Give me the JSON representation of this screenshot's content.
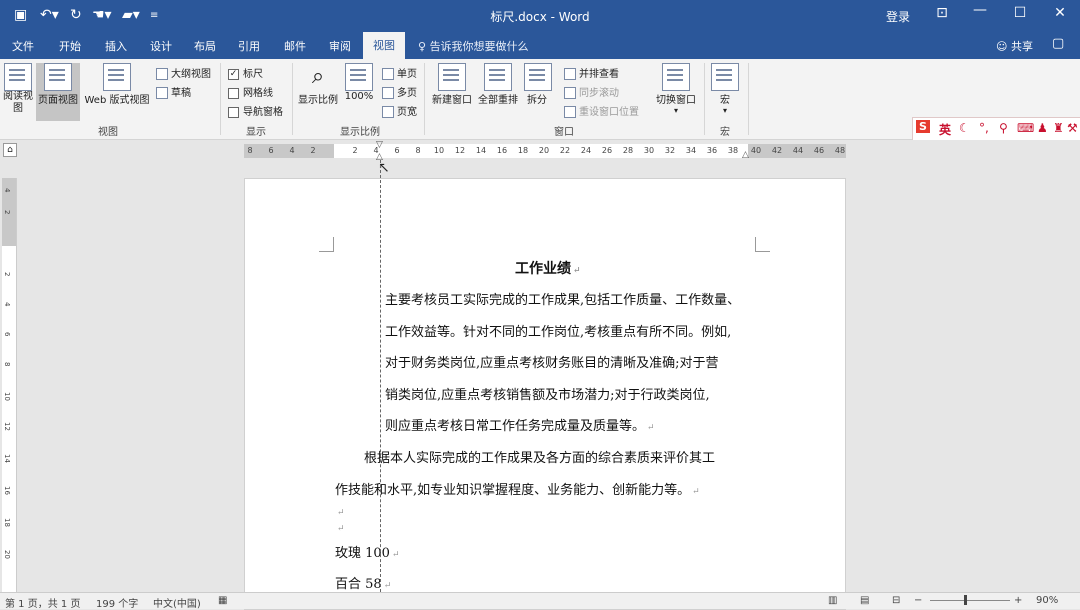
{
  "titlebar": {
    "title": "标尺.docx - Word",
    "login": "登录",
    "qa_icons": [
      "save-icon",
      "undo-icon",
      "redo-icon",
      "touch-icon",
      "open-folder-icon",
      "customize-icon"
    ]
  },
  "tabs": [
    "文件",
    "开始",
    "插入",
    "设计",
    "布局",
    "引用",
    "邮件",
    "审阅",
    "视图"
  ],
  "active_tab": "视图",
  "tell_me": "告诉我你想要做什么",
  "share": "共享",
  "ribbon": {
    "views": {
      "label": "视图",
      "read": "阅读视图",
      "print_layout": "页面视图",
      "web": "Web 版式视图",
      "outline": "大纲视图",
      "draft": "草稿"
    },
    "show": {
      "label": "显示",
      "ruler": "标尺",
      "gridlines": "网格线",
      "nav_pane": "导航窗格"
    },
    "zoom": {
      "label": "显示比例",
      "zoom": "显示比例",
      "pct100": "100%",
      "one_page": "单页",
      "multi_page": "多页",
      "page_width": "页宽"
    },
    "window": {
      "label": "窗口",
      "new_window": "新建窗口",
      "arrange_all": "全部重排",
      "split": "拆分",
      "side_by_side": "并排查看",
      "sync_scroll": "同步滚动",
      "reset_pos": "重设窗口位置",
      "switch": "切换窗口"
    },
    "macros": {
      "label": "宏",
      "macros": "宏"
    }
  },
  "ime": {
    "lang": "英"
  },
  "ruler": {
    "left_gray": [
      "8",
      "6",
      "4",
      "2"
    ],
    "nums": [
      "2",
      "4",
      "6",
      "8",
      "10",
      "12",
      "14",
      "16",
      "18",
      "20",
      "22",
      "24",
      "26",
      "28",
      "30",
      "32",
      "34",
      "36",
      "38"
    ],
    "right_gray": [
      "40",
      "42",
      "44",
      "46",
      "48"
    ],
    "vnums": [
      "4",
      "2",
      "2",
      "4",
      "6",
      "8",
      "10",
      "12",
      "14",
      "16",
      "18",
      "20"
    ]
  },
  "document": {
    "heading": "工作业绩",
    "p1": [
      "主要考核员工实际完成的工作成果,包括工作质量、工作数量、",
      "工作效益等。针对不同的工作岗位,考核重点有所不同。例如,",
      "对于财务类岗位,应重点考核财务账目的清晰及准确;对于营",
      "销类岗位,应重点考核销售额及市场潜力;对于行政类岗位,",
      "则应重点考核日常工作任务完成量及质量等。"
    ],
    "p2": [
      "根据本人实际完成的工作成果及各方面的综合素质来评价其工",
      "作技能和水平,如专业知识掌握程度、业务能力、创新能力等。"
    ],
    "item1": "玫瑰 100",
    "item2": "百合 58"
  },
  "status": {
    "page": "第 1 页，共 1 页",
    "words": "199 个字",
    "lang": "中文(中国)",
    "zoom": "90%"
  }
}
